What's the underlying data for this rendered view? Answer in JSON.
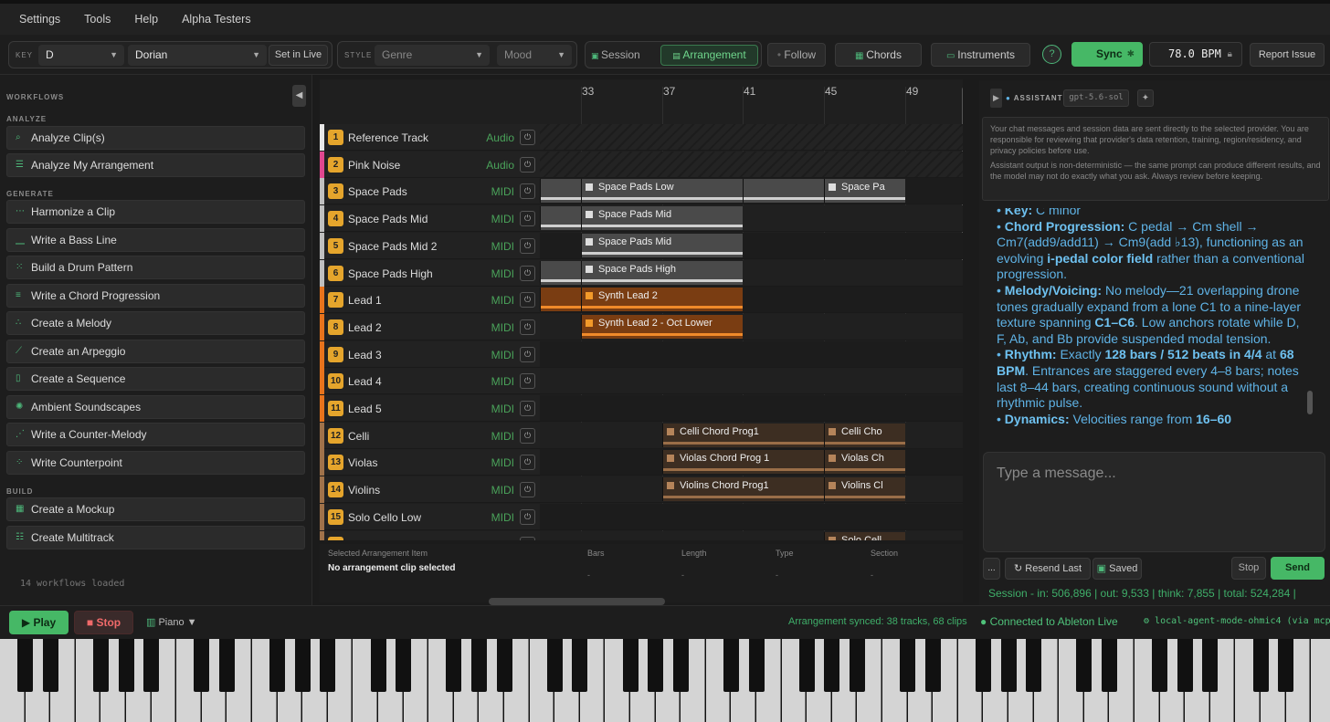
{
  "menu": [
    "Settings",
    "Tools",
    "Help",
    "Alpha Testers"
  ],
  "toolbar": {
    "key_label": "KEY",
    "key_value": "D",
    "mode_value": "Dorian",
    "set_in_live": "Set in Live",
    "style_label": "STYLE",
    "genre": "Genre",
    "mood": "Mood",
    "session": "Session",
    "arrangement": "Arrangement",
    "follow": "Follow",
    "chords": "Chords",
    "instruments": "Instruments",
    "help": "?",
    "sync": "Sync",
    "bpm": "78.0 BPM",
    "report": "Report Issue"
  },
  "sidebar": {
    "title": "WORKFLOWS",
    "sections": [
      {
        "name": "ANALYZE",
        "items": [
          "Analyze Clip(s)",
          "Analyze My Arrangement"
        ]
      },
      {
        "name": "GENERATE",
        "items": [
          "Harmonize a Clip",
          "Write a Bass Line",
          "Build a Drum Pattern",
          "Write a Chord Progression",
          "Create a Melody",
          "Create an Arpeggio",
          "Create a Sequence",
          "Ambient Soundscapes",
          "Write a Counter-Melody",
          "Write Counterpoint"
        ]
      },
      {
        "name": "BUILD",
        "items": [
          "Create a Mockup",
          "Create Multitrack"
        ]
      }
    ],
    "footer": "14 workflows loaded"
  },
  "arrangement": {
    "bars": [
      "33",
      "37",
      "41",
      "45",
      "49"
    ],
    "tracks": [
      {
        "num": "1",
        "name": "Reference Track",
        "type": "Audio",
        "color": "#e8e8e8"
      },
      {
        "num": "2",
        "name": "Pink Noise",
        "type": "Audio",
        "color": "#e0478f"
      },
      {
        "num": "3",
        "name": "Space Pads",
        "type": "MIDI",
        "color": "#bfbfbf"
      },
      {
        "num": "4",
        "name": "Space Pads Mid",
        "type": "MIDI",
        "color": "#bfbfbf"
      },
      {
        "num": "5",
        "name": "Space Pads Mid 2",
        "type": "MIDI",
        "color": "#bfbfbf"
      },
      {
        "num": "6",
        "name": "Space Pads High",
        "type": "MIDI",
        "color": "#bfbfbf"
      },
      {
        "num": "7",
        "name": "Lead 1",
        "type": "MIDI",
        "color": "#e8731c"
      },
      {
        "num": "8",
        "name": "Lead 2",
        "type": "MIDI",
        "color": "#e8731c"
      },
      {
        "num": "9",
        "name": "Lead 3",
        "type": "MIDI",
        "color": "#e8731c"
      },
      {
        "num": "10",
        "name": "Lead 4",
        "type": "MIDI",
        "color": "#e8731c"
      },
      {
        "num": "11",
        "name": "Lead 5",
        "type": "MIDI",
        "color": "#e8731c"
      },
      {
        "num": "12",
        "name": "Celli",
        "type": "MIDI",
        "color": "#a0724a"
      },
      {
        "num": "13",
        "name": "Violas",
        "type": "MIDI",
        "color": "#a0724a"
      },
      {
        "num": "14",
        "name": "Violins",
        "type": "MIDI",
        "color": "#a0724a"
      },
      {
        "num": "15",
        "name": "Solo Cello Low",
        "type": "MIDI",
        "color": "#a0724a"
      },
      {
        "num": "16",
        "name": "Solo Cello Mid",
        "type": "MIDI",
        "color": "#a0724a"
      }
    ],
    "clips": [
      {
        "row": 2,
        "col": 0,
        "name": "",
        "kind": "gray"
      },
      {
        "row": 2,
        "col": 1,
        "name": "Space Pads Low",
        "kind": "gray"
      },
      {
        "row": 2,
        "col": 3,
        "name": "",
        "kind": "gray"
      },
      {
        "row": 2,
        "col": 4,
        "name": "Space Pa",
        "kind": "gray"
      },
      {
        "row": 3,
        "col": 0,
        "name": "",
        "kind": "gray"
      },
      {
        "row": 3,
        "col": 1,
        "name": "Space Pads Mid",
        "kind": "gray"
      },
      {
        "row": 4,
        "col": 1,
        "name": "Space Pads Mid",
        "kind": "gray"
      },
      {
        "row": 5,
        "col": 0,
        "name": "",
        "kind": "gray"
      },
      {
        "row": 5,
        "col": 1,
        "name": "Space Pads High",
        "kind": "gray"
      },
      {
        "row": 6,
        "col": 0,
        "name": "",
        "kind": "orange"
      },
      {
        "row": 6,
        "col": 1,
        "name": "Synth Lead 2",
        "kind": "orange"
      },
      {
        "row": 7,
        "col": 1,
        "name": "Synth Lead 2 - Oct Lower",
        "kind": "orange"
      },
      {
        "row": 11,
        "col": 2,
        "name": "Celli Chord Prog1",
        "kind": "brown"
      },
      {
        "row": 11,
        "col": 4,
        "name": "Celli Cho",
        "kind": "brown"
      },
      {
        "row": 12,
        "col": 2,
        "name": "Violas Chord Prog 1",
        "kind": "brown"
      },
      {
        "row": 12,
        "col": 4,
        "name": "Violas Ch",
        "kind": "brown"
      },
      {
        "row": 13,
        "col": 2,
        "name": "Violins Chord Prog1",
        "kind": "brown"
      },
      {
        "row": 13,
        "col": 4,
        "name": "Violins Cl",
        "kind": "brown"
      },
      {
        "row": 15,
        "col": 4,
        "name": "Solo Cell",
        "kind": "brown"
      }
    ],
    "info": {
      "title": "Selected Arrangement Item",
      "value": "No arrangement clip selected",
      "cols": [
        "Bars",
        "Length",
        "Type",
        "Section"
      ],
      "dash": "-"
    }
  },
  "assistant": {
    "label": "ASSISTANT",
    "model": "gpt-5.6-sol",
    "disclaimer1": "Your chat messages and session data are sent directly to the selected provider. You are responsible for reviewing that provider's data retention, training, region/residency, and privacy policies before use.",
    "disclaimer2": "Assistant output is non-deterministic — the same prompt can produce different results, and the model may not do exactly what you ask. Always review before keeping.",
    "placeholder": "Type a message...",
    "more": "...",
    "resend": "Resend Last",
    "saved": "Saved",
    "stop": "Stop",
    "send": "Send",
    "session_stats": "Session - in: 506,896 | out: 9,533 | think: 7,855 | total: 524,284 |"
  },
  "chat": {
    "key_label": "Key:",
    "key_text": "C minor",
    "chord_label": "Chord Progression:",
    "chord_text": "C pedal → Cm shell → Cm7(add9/add11) → Cm9(add ♭13), functioning as an evolving",
    "chord_bold": "i-pedal color field",
    "chord_text2": "rather than a conventional progression.",
    "melody_label": "Melody/Voicing:",
    "melody_text": "No melody—21 overlapping drone tones gradually expand from a lone C1 to a nine-layer texture spanning",
    "melody_bold": "C1–C6",
    "melody_text2": ". Low anchors rotate while D, F, Ab, and Bb provide suspended modal tension.",
    "rhythm_label": "Rhythm:",
    "rhythm_t1": "Exactly",
    "rhythm_b1": "128 bars / 512 beats in 4/4",
    "rhythm_t2": "at",
    "rhythm_b2": "68 BPM",
    "rhythm_t3": ". Entrances are staggered every 4–8 bars; notes last 8–44 bars, creating continuous sound without a rhythmic pulse.",
    "dyn_label": "Dynamics:",
    "dyn_text": "Velocities range from",
    "dyn_bold": "16–60"
  },
  "bottom": {
    "play": "Play",
    "stop": "Stop",
    "piano": "Piano",
    "synced": "Arrangement synced: 38 tracks, 68 clips",
    "connected": "Connected to Ableton Live",
    "agent": "local-agent-mode-ohmic4 (via mcp"
  },
  "colors": {
    "accent": "#4db87a",
    "sync": "#46b866",
    "orange": "#e8731c",
    "brown": "#a0724a",
    "chat": "#5fb3e6"
  }
}
